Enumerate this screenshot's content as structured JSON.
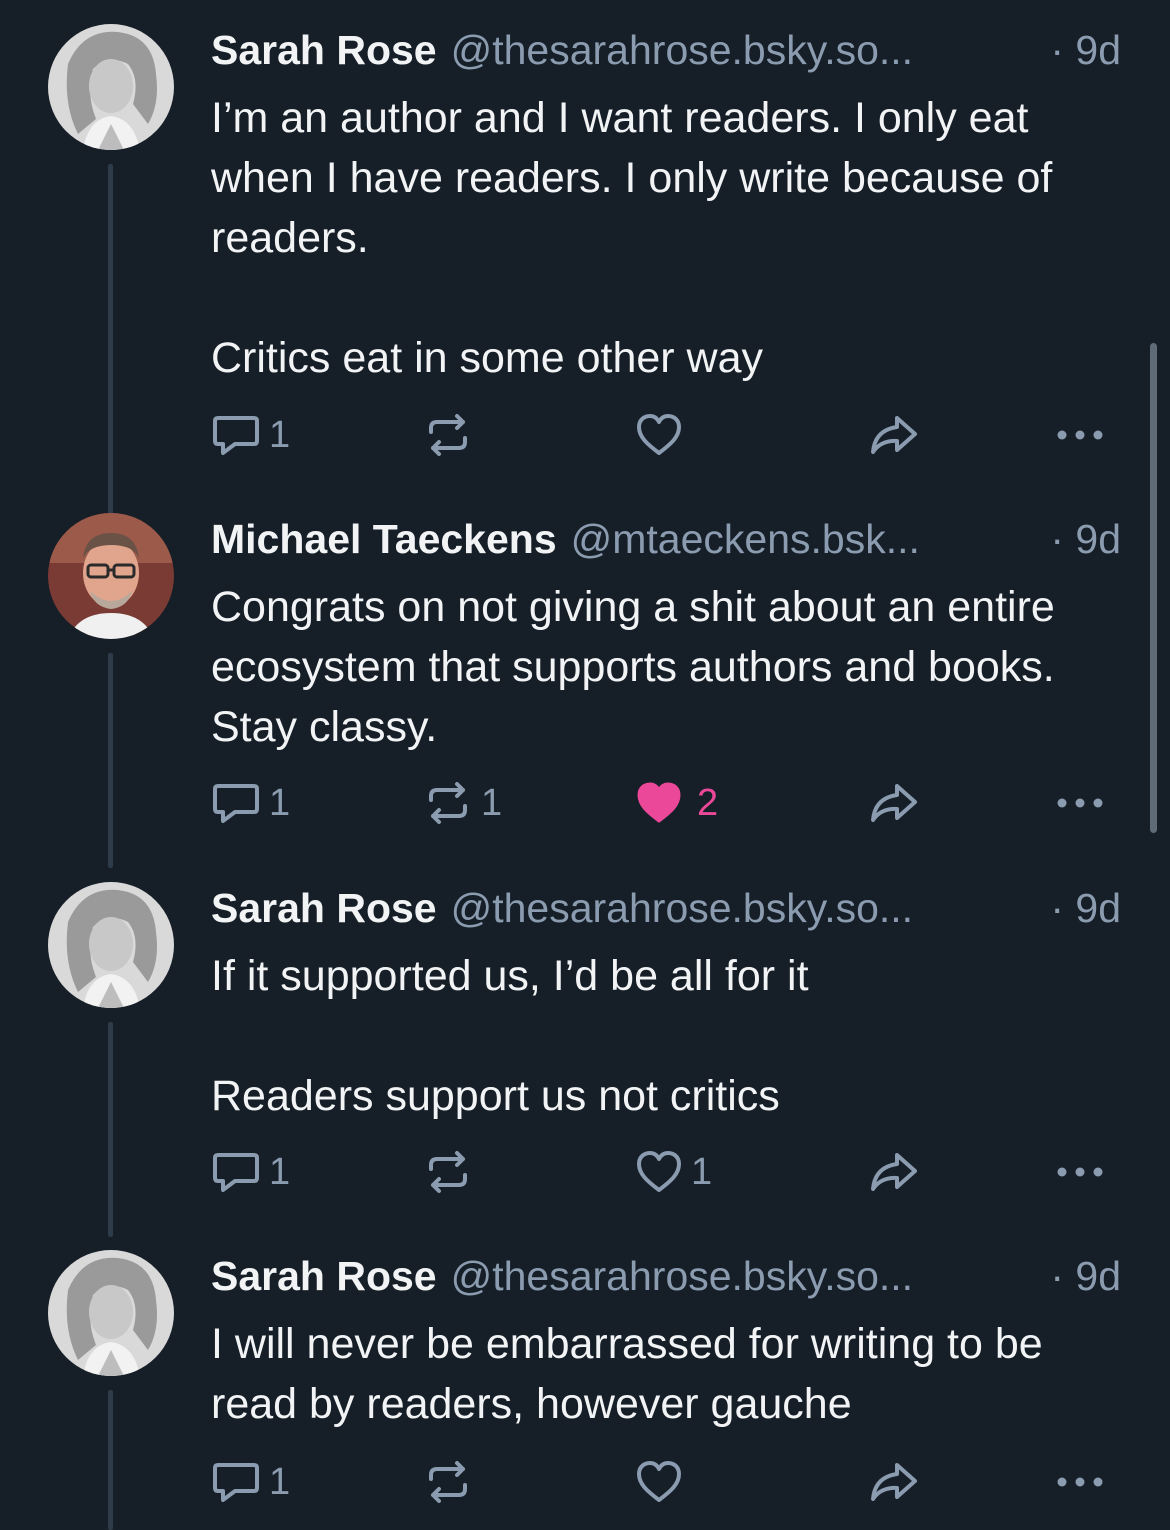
{
  "posts": [
    {
      "author_name": "Sarah Rose",
      "handle": "@thesarahrose.bsky.so...",
      "time": "· 9d",
      "avatar_icon": "sarah-rose-avatar",
      "paragraphs": [
        "I’m an author and I want readers. I only eat when I have readers. I only write because of readers.",
        "Critics eat in some other way"
      ],
      "replies": "1",
      "reposts": "",
      "likes": "",
      "liked": false
    },
    {
      "author_name": "Michael Taeckens",
      "handle": "@mtaeckens.bsk...",
      "time": "· 9d",
      "avatar_icon": "michael-taeckens-avatar",
      "paragraphs": [
        "Congrats on not giving a shit about an entire ecosystem that supports authors and books. Stay classy."
      ],
      "replies": "1",
      "reposts": "1",
      "likes": "2",
      "liked": true
    },
    {
      "author_name": "Sarah Rose",
      "handle": "@thesarahrose.bsky.so...",
      "time": "· 9d",
      "avatar_icon": "sarah-rose-avatar",
      "paragraphs": [
        "If it supported us, I’d be all for it",
        "Readers support us not critics"
      ],
      "replies": "1",
      "reposts": "",
      "likes": "1",
      "liked": false
    },
    {
      "author_name": "Sarah Rose",
      "handle": "@thesarahrose.bsky.so...",
      "time": "· 9d",
      "avatar_icon": "sarah-rose-avatar",
      "paragraphs": [
        "I will never be embarrassed for writing to be read by readers, however gauche"
      ],
      "replies": "1",
      "reposts": "",
      "likes": "",
      "liked": false
    }
  ],
  "colors": {
    "background": "#161e27",
    "text": "#f1f3f5",
    "muted": "#8b9cb0",
    "like_active": "#ec4899",
    "thread_line": "#2e3b49"
  }
}
